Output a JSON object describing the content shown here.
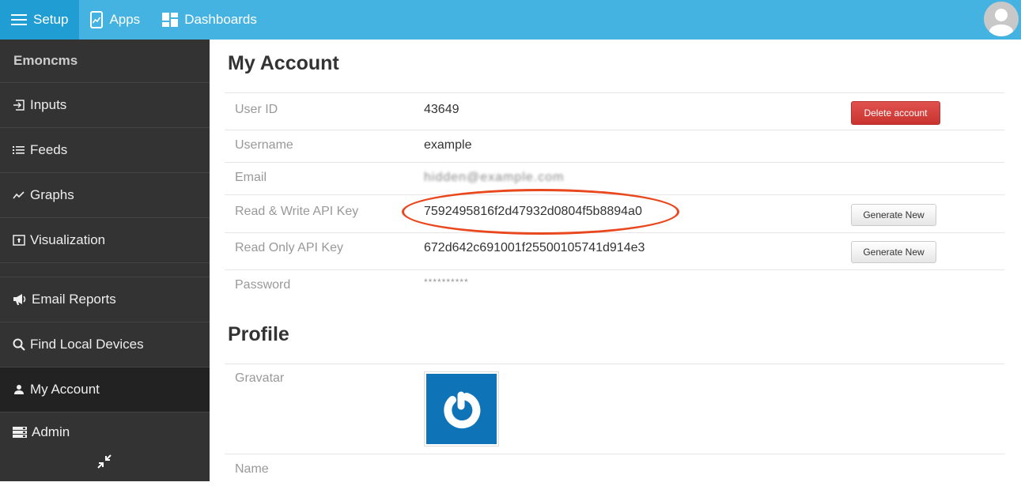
{
  "topbar": {
    "items": [
      {
        "label": "Setup",
        "icon": "hamburger-icon",
        "active": true
      },
      {
        "label": "Apps",
        "icon": "apps-icon",
        "active": false
      },
      {
        "label": "Dashboards",
        "icon": "dashboards-icon",
        "active": false
      }
    ],
    "avatar_icon": "user-avatar-icon"
  },
  "sidebar": {
    "title": "Emoncms",
    "items": [
      {
        "label": "Inputs",
        "icon": "inputs-icon"
      },
      {
        "label": "Feeds",
        "icon": "list-icon"
      },
      {
        "label": "Graphs",
        "icon": "graph-icon"
      },
      {
        "label": "Visualization",
        "icon": "visualization-icon"
      },
      {
        "label": "Email Reports",
        "icon": "megaphone-icon"
      },
      {
        "label": "Find Local Devices",
        "icon": "search-icon"
      },
      {
        "label": "My Account",
        "icon": "user-icon",
        "active": true
      },
      {
        "label": "Admin",
        "icon": "server-icon"
      }
    ],
    "collapse_icon": "collapse-icon"
  },
  "account": {
    "title": "My Account",
    "rows": [
      {
        "label": "User ID",
        "value": "43649",
        "button": "Delete account"
      },
      {
        "label": "Username",
        "value": "example"
      },
      {
        "label": "Email",
        "value": "hidden@example.com",
        "blurred": true
      },
      {
        "label": "Read & Write API Key",
        "value": "7592495816f2d47932d0804f5b8894a0",
        "button": "Generate New",
        "highlighted": true
      },
      {
        "label": "Read Only API Key",
        "value": "672d642c691001f25500105741d914e3",
        "button": "Generate New"
      },
      {
        "label": "Password",
        "value": "**********"
      }
    ]
  },
  "profile": {
    "title": "Profile",
    "rows": [
      {
        "label": "Gravatar",
        "icon": "gravatar-icon"
      },
      {
        "label": "Name",
        "value": ""
      }
    ]
  },
  "colors": {
    "topbar": "#44b3e2",
    "topbar_active": "#209ed3",
    "sidebar": "#333333",
    "sidebar_active": "#222222",
    "danger": "#d9413d",
    "annotation": "#e9471e",
    "gravatar_bg": "#0f73b8"
  }
}
